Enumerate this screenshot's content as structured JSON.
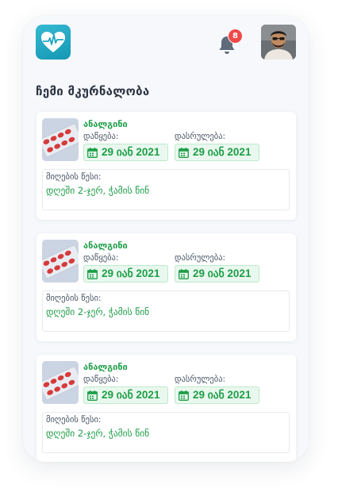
{
  "header": {
    "notification_count": "8",
    "logo_icon": "heart-pulse-icon",
    "bell_icon": "bell-icon"
  },
  "page": {
    "title": "ჩემი მკურნალობა"
  },
  "colors": {
    "accent_green": "#1e9e48",
    "logo_blue": "#1ea6c3",
    "badge_red": "#f04848"
  },
  "treatments": [
    {
      "name": "ანალგინი",
      "start_label": "დაწყება:",
      "start_date": "29 იან 2021",
      "end_label": "დასრულება:",
      "end_date": "29 იან 2021",
      "rule_label": "მიღების წესი:",
      "rule_value": "დღეში 2-ჯერ, ჭამის წინ"
    },
    {
      "name": "ანალგინი",
      "start_label": "დაწყება:",
      "start_date": "29 იან 2021",
      "end_label": "დასრულება:",
      "end_date": "29 იან 2021",
      "rule_label": "მიღების წესი:",
      "rule_value": "დღეში 2-ჯერ, ჭამის წინ"
    },
    {
      "name": "ანალგინი",
      "start_label": "დაწყება:",
      "start_date": "29 იან 2021",
      "end_label": "დასრულება:",
      "end_date": "29 იან 2021",
      "rule_label": "მიღების წესი:",
      "rule_value": "დღეში 2-ჯერ, ჭამის წინ"
    }
  ]
}
